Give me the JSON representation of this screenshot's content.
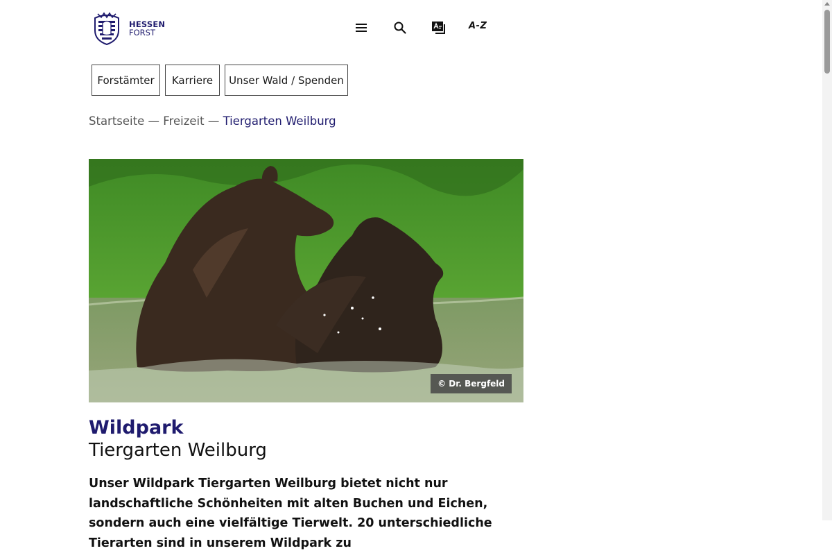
{
  "header": {
    "logo_line1": "HESSEN",
    "logo_line2": "FORST",
    "az_label": "A-Z",
    "icons": [
      "menu-icon",
      "search-icon",
      "easy-language-icon"
    ]
  },
  "nav": {
    "items": [
      {
        "label": "Forstämter"
      },
      {
        "label": "Karriere"
      },
      {
        "label": "Unser Wald / Spenden"
      }
    ]
  },
  "breadcrumb": {
    "items": [
      "Startseite",
      "Freizeit"
    ],
    "separator": " — ",
    "current": "Tiergarten Weilburg"
  },
  "hero": {
    "credit": "© Dr. Bergfeld"
  },
  "article": {
    "title_line1": "Wildpark",
    "title_line2": "Tiergarten Weilburg",
    "intro": "Unser Wildpark Tiergarten Weilburg bietet nicht nur landschaftliche Schönheiten mit alten Buchen und Eichen, sondern auch eine vielfältige Tierwelt. 20 unterschiedliche Tierarten sind in unserem Wildpark zu"
  },
  "colors": {
    "brand": "#1f1b6e",
    "text": "#111111",
    "border": "#444444"
  }
}
